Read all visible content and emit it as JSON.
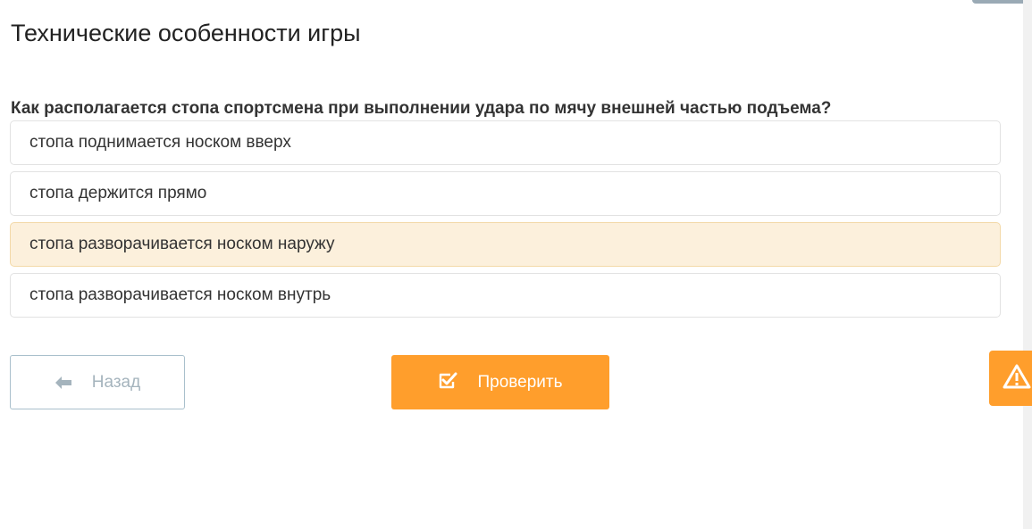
{
  "page": {
    "title": "Технические особенности игры"
  },
  "question": {
    "text": "Как располагается стопа спортсмена при выполнении удара по мячу внешней частью подъема?"
  },
  "options": [
    {
      "label": "стопа поднимается носком вверх",
      "selected": false
    },
    {
      "label": "стопа держится прямо",
      "selected": false
    },
    {
      "label": "стопа разворачивается носком наружу",
      "selected": true
    },
    {
      "label": "стопа разворачивается носком внутрь",
      "selected": false
    }
  ],
  "buttons": {
    "back_label": "Назад",
    "back_icon": "arrow-left-icon",
    "check_label": "Проверить",
    "check_icon": "checkbox-check-icon"
  },
  "report": {
    "icon": "warning-triangle-icon"
  },
  "colors": {
    "accent": "#ff9e2c",
    "selected_bg": "#fcf0dc",
    "back_text": "#a5b4bd"
  }
}
